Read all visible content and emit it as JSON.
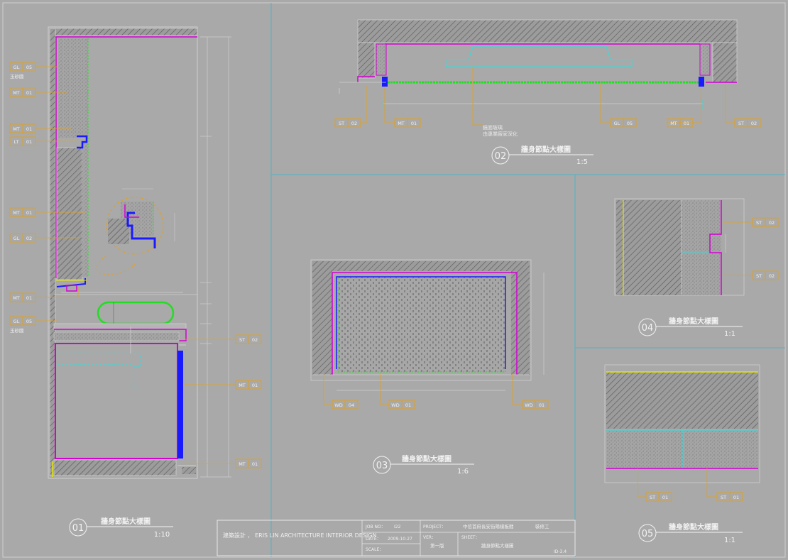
{
  "colors": {
    "background": "#a9a9a9",
    "frame": "#cfcfcf",
    "divider": "#4fb3c8",
    "tag": "#e0a020",
    "magenta": "#d400d4",
    "blue": "#1a1aff",
    "green": "#22dd22",
    "cyan": "#33dddd",
    "yellow": "#e6e600",
    "hatch": "#555555"
  },
  "details": [
    {
      "num": "01",
      "title": "牆身節點大樣圖",
      "scale": "1:10"
    },
    {
      "num": "02",
      "title": "牆身節點大樣圖",
      "scale": "1:5"
    },
    {
      "num": "03",
      "title": "牆身節點大樣圖",
      "scale": "1:6"
    },
    {
      "num": "04",
      "title": "牆身節點大樣圖",
      "scale": "1:1"
    },
    {
      "num": "05",
      "title": "牆身節點大樣圖",
      "scale": "1:1"
    }
  ],
  "tags": {
    "d01": [
      {
        "code": "GL",
        "num": "05",
        "sub": "玉砂圆"
      },
      {
        "code": "MT",
        "num": "01"
      },
      {
        "code": "MT",
        "num": "01"
      },
      {
        "code": "LT",
        "num": "01"
      },
      {
        "code": "MT",
        "num": "01"
      },
      {
        "code": "GL",
        "num": "02"
      },
      {
        "code": "MT",
        "num": "01"
      },
      {
        "code": "GL",
        "num": "05",
        "sub": "玉砂圆"
      },
      {
        "code": "ST",
        "num": "02"
      },
      {
        "code": "MT",
        "num": "01"
      },
      {
        "code": "MT",
        "num": "01"
      }
    ],
    "d02": [
      {
        "code": "ST",
        "num": "02"
      },
      {
        "code": "MT",
        "num": "01"
      },
      {
        "code": "GL",
        "num": "05"
      },
      {
        "code": "MT",
        "num": "01"
      },
      {
        "code": "ST",
        "num": "02"
      }
    ],
    "d02_note": [
      "鏡面玻璃",
      "由專業廠家深化"
    ],
    "d03": [
      {
        "code": "WD",
        "num": "04"
      },
      {
        "code": "WD",
        "num": "01"
      },
      {
        "code": "WD",
        "num": "01"
      }
    ],
    "d04": [
      {
        "code": "ST",
        "num": "02"
      },
      {
        "code": "ST",
        "num": "02"
      }
    ],
    "d05": [
      {
        "code": "ST",
        "num": "01"
      },
      {
        "code": "ST",
        "num": "01"
      }
    ]
  },
  "titleblock": {
    "company": "建築設計 ， ERIS LIN ARCHITECTURE INTERIOR DESIGN",
    "job_no_label": "JOB NO：",
    "job_no_value": "I22",
    "date_label": "DATE：",
    "date_value": "2009-10-27",
    "scale_label": "SCALE：",
    "project_label": "PROJECT：",
    "project_value": "中信首府長安街陽樣板間",
    "project_value2": "裝修工",
    "ver_label": "VER：",
    "ver_value": "第一版",
    "sheet_label": "SHEET：",
    "sheet_value": "牆身節點大樣圖",
    "sheet_no": "ID-3.4"
  }
}
